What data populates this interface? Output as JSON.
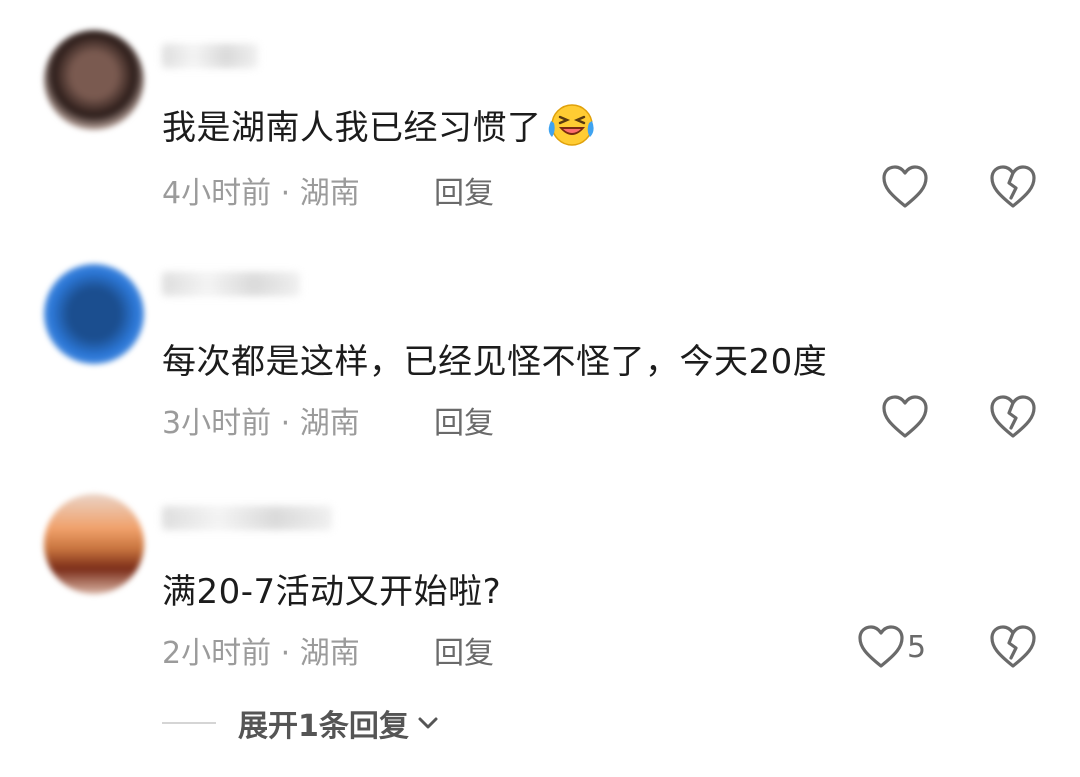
{
  "comments": [
    {
      "text": "我是湖南人我已经习惯了",
      "has_emoji": true,
      "emoji_icon": "laughing-crying-face-icon",
      "time_location": "4小时前 · 湖南",
      "reply_label": "回复",
      "like_count": ""
    },
    {
      "text": "每次都是这样，已经见怪不怪了，今天20度",
      "has_emoji": false,
      "time_location": "3小时前 · 湖南",
      "reply_label": "回复",
      "like_count": ""
    },
    {
      "text": "满20-7活动又开始啦?",
      "has_emoji": false,
      "time_location": "2小时前 · 湖南",
      "reply_label": "回复",
      "like_count": "5"
    }
  ],
  "expand_replies": {
    "label": "展开1条回复"
  },
  "icons": {
    "like": "heart-outline-icon",
    "dislike": "broken-heart-icon",
    "expand": "chevron-down-icon"
  },
  "colors": {
    "text": "#1c1c1c",
    "meta": "#9b9b9b",
    "icon": "#6a6a6a"
  }
}
